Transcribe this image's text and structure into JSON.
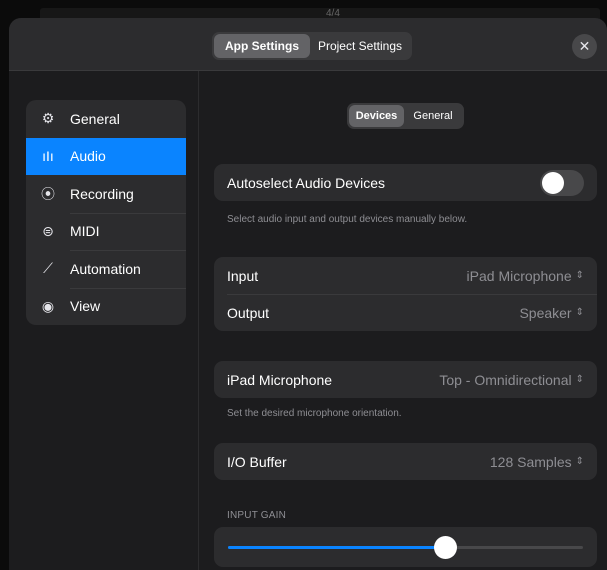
{
  "backdrop": {
    "text": "4/4"
  },
  "topbar": {
    "tabs": [
      {
        "label": "App Settings",
        "selected": true
      },
      {
        "label": "Project Settings",
        "selected": false
      }
    ],
    "close_icon": "xmark"
  },
  "sidebar": {
    "items": [
      {
        "label": "General",
        "icon": "gear-icon",
        "glyph": "⚙"
      },
      {
        "label": "Audio",
        "icon": "waveform-icon",
        "glyph": "ıIı",
        "active": true
      },
      {
        "label": "Recording",
        "icon": "record-icon",
        "glyph": "⦿"
      },
      {
        "label": "MIDI",
        "icon": "midi-icon",
        "glyph": "⊜"
      },
      {
        "label": "Automation",
        "icon": "automation-icon",
        "glyph": "⟋"
      },
      {
        "label": "View",
        "icon": "eye-icon",
        "glyph": "◉"
      }
    ]
  },
  "main": {
    "subtabs": [
      {
        "label": "Devices",
        "selected": true
      },
      {
        "label": "General",
        "selected": false
      }
    ],
    "autoselect": {
      "label": "Autoselect Audio Devices",
      "enabled": false,
      "footnote": "Select audio input and output devices manually below."
    },
    "io": {
      "input_label": "Input",
      "input_value": "iPad Microphone",
      "output_label": "Output",
      "output_value": "Speaker"
    },
    "mic": {
      "label": "iPad Microphone",
      "value": "Top - Omnidirectional",
      "footnote": "Set the desired microphone orientation."
    },
    "buffer": {
      "label": "I/O Buffer",
      "value": "128 Samples"
    },
    "gain": {
      "header": "INPUT GAIN",
      "level": 0.61
    }
  },
  "colors": {
    "accent": "#0a84ff",
    "background": "#1c1c1e",
    "cell": "#2c2c2e",
    "secondary_text": "#8e8e93"
  }
}
